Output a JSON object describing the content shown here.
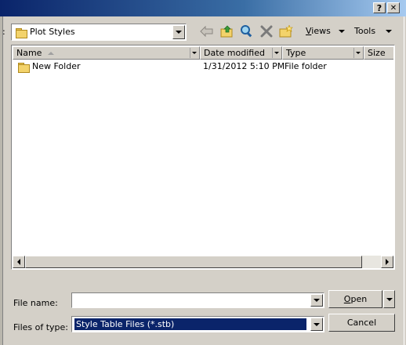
{
  "title_bar": {
    "help_label": "?",
    "close_label": "✕"
  },
  "look_in": {
    "colon": ":",
    "value": "Plot Styles"
  },
  "toolbar": {
    "views_label": "Views",
    "tools_label": "Tools"
  },
  "file_list": {
    "columns": [
      "Name",
      "Date modified",
      "Type",
      "Size"
    ],
    "rows": [
      {
        "name": "New Folder",
        "date_modified": "1/31/2012 5:10 PM",
        "type": "File folder",
        "size": ""
      }
    ]
  },
  "file_name": {
    "label": "File name:",
    "value": ""
  },
  "files_of_type": {
    "label": "Files of type:",
    "value": "Style Table Files (*.stb)"
  },
  "buttons": {
    "open_label": "Open",
    "cancel_label": "Cancel"
  },
  "colors": {
    "title_start": "#0a246a",
    "title_end": "#a6caf0",
    "selection": "#0a246a",
    "face": "#d4d0c8"
  }
}
